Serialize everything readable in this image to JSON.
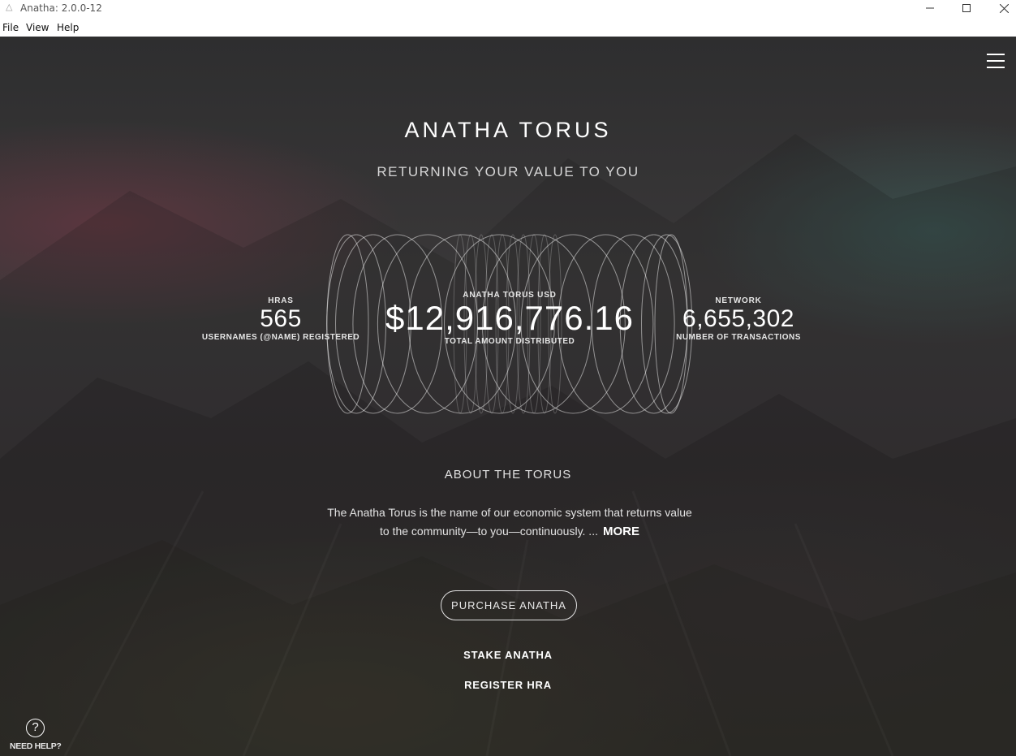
{
  "window": {
    "title": "Anatha: 2.0.0-12"
  },
  "menu": [
    "File",
    "View",
    "Help"
  ],
  "hero": {
    "title": "ANATHA TORUS",
    "subtitle": "RETURNING YOUR VALUE TO YOU"
  },
  "stats": {
    "hras": {
      "label": "HRAS",
      "value": "565",
      "caption": "USERNAMES (@NAME) REGISTERED"
    },
    "torus": {
      "label": "ANATHA TORUS USD",
      "value": "$12,916,776.16",
      "caption": "TOTAL AMOUNT DISTRIBUTED"
    },
    "network": {
      "label": "NETWORK",
      "value": "6,655,302",
      "caption": "NUMBER OF TRANSACTIONS"
    }
  },
  "about": {
    "title": "ABOUT THE TORUS",
    "text_line1": "The Anatha Torus is the name of our economic system that returns value",
    "text_line2": "to the community—to you—continuously. ...",
    "more": "MORE"
  },
  "actions": {
    "purchase": "PURCHASE ANATHA",
    "stake": "STAKE ANATHA",
    "register": "REGISTER HRA"
  },
  "help": {
    "label": "NEED HELP?",
    "icon": "question-circle-icon"
  },
  "icons": {
    "menu": "hamburger-icon",
    "minimize": "minimize-icon",
    "maximize": "maximize-icon",
    "close": "close-icon"
  },
  "colors": {
    "background": "#333233",
    "text": "#ffffff",
    "accent_pink": "#783746",
    "accent_teal": "#3c645f"
  }
}
